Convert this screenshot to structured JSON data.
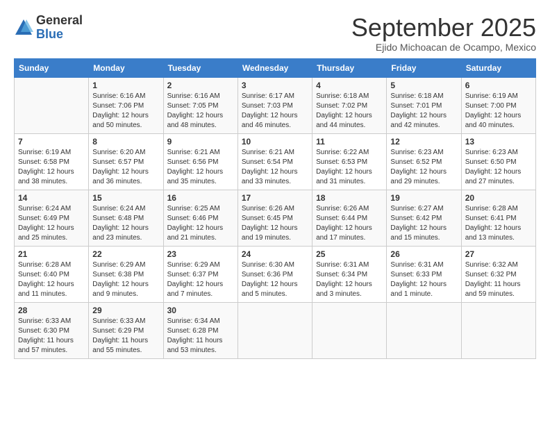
{
  "logo": {
    "general": "General",
    "blue": "Blue"
  },
  "header": {
    "month": "September 2025",
    "location": "Ejido Michoacan de Ocampo, Mexico"
  },
  "days_of_week": [
    "Sunday",
    "Monday",
    "Tuesday",
    "Wednesday",
    "Thursday",
    "Friday",
    "Saturday"
  ],
  "weeks": [
    [
      {
        "day": "",
        "info": ""
      },
      {
        "day": "1",
        "info": "Sunrise: 6:16 AM\nSunset: 7:06 PM\nDaylight: 12 hours\nand 50 minutes."
      },
      {
        "day": "2",
        "info": "Sunrise: 6:16 AM\nSunset: 7:05 PM\nDaylight: 12 hours\nand 48 minutes."
      },
      {
        "day": "3",
        "info": "Sunrise: 6:17 AM\nSunset: 7:03 PM\nDaylight: 12 hours\nand 46 minutes."
      },
      {
        "day": "4",
        "info": "Sunrise: 6:18 AM\nSunset: 7:02 PM\nDaylight: 12 hours\nand 44 minutes."
      },
      {
        "day": "5",
        "info": "Sunrise: 6:18 AM\nSunset: 7:01 PM\nDaylight: 12 hours\nand 42 minutes."
      },
      {
        "day": "6",
        "info": "Sunrise: 6:19 AM\nSunset: 7:00 PM\nDaylight: 12 hours\nand 40 minutes."
      }
    ],
    [
      {
        "day": "7",
        "info": "Sunrise: 6:19 AM\nSunset: 6:58 PM\nDaylight: 12 hours\nand 38 minutes."
      },
      {
        "day": "8",
        "info": "Sunrise: 6:20 AM\nSunset: 6:57 PM\nDaylight: 12 hours\nand 36 minutes."
      },
      {
        "day": "9",
        "info": "Sunrise: 6:21 AM\nSunset: 6:56 PM\nDaylight: 12 hours\nand 35 minutes."
      },
      {
        "day": "10",
        "info": "Sunrise: 6:21 AM\nSunset: 6:54 PM\nDaylight: 12 hours\nand 33 minutes."
      },
      {
        "day": "11",
        "info": "Sunrise: 6:22 AM\nSunset: 6:53 PM\nDaylight: 12 hours\nand 31 minutes."
      },
      {
        "day": "12",
        "info": "Sunrise: 6:23 AM\nSunset: 6:52 PM\nDaylight: 12 hours\nand 29 minutes."
      },
      {
        "day": "13",
        "info": "Sunrise: 6:23 AM\nSunset: 6:50 PM\nDaylight: 12 hours\nand 27 minutes."
      }
    ],
    [
      {
        "day": "14",
        "info": "Sunrise: 6:24 AM\nSunset: 6:49 PM\nDaylight: 12 hours\nand 25 minutes."
      },
      {
        "day": "15",
        "info": "Sunrise: 6:24 AM\nSunset: 6:48 PM\nDaylight: 12 hours\nand 23 minutes."
      },
      {
        "day": "16",
        "info": "Sunrise: 6:25 AM\nSunset: 6:46 PM\nDaylight: 12 hours\nand 21 minutes."
      },
      {
        "day": "17",
        "info": "Sunrise: 6:26 AM\nSunset: 6:45 PM\nDaylight: 12 hours\nand 19 minutes."
      },
      {
        "day": "18",
        "info": "Sunrise: 6:26 AM\nSunset: 6:44 PM\nDaylight: 12 hours\nand 17 minutes."
      },
      {
        "day": "19",
        "info": "Sunrise: 6:27 AM\nSunset: 6:42 PM\nDaylight: 12 hours\nand 15 minutes."
      },
      {
        "day": "20",
        "info": "Sunrise: 6:28 AM\nSunset: 6:41 PM\nDaylight: 12 hours\nand 13 minutes."
      }
    ],
    [
      {
        "day": "21",
        "info": "Sunrise: 6:28 AM\nSunset: 6:40 PM\nDaylight: 12 hours\nand 11 minutes."
      },
      {
        "day": "22",
        "info": "Sunrise: 6:29 AM\nSunset: 6:38 PM\nDaylight: 12 hours\nand 9 minutes."
      },
      {
        "day": "23",
        "info": "Sunrise: 6:29 AM\nSunset: 6:37 PM\nDaylight: 12 hours\nand 7 minutes."
      },
      {
        "day": "24",
        "info": "Sunrise: 6:30 AM\nSunset: 6:36 PM\nDaylight: 12 hours\nand 5 minutes."
      },
      {
        "day": "25",
        "info": "Sunrise: 6:31 AM\nSunset: 6:34 PM\nDaylight: 12 hours\nand 3 minutes."
      },
      {
        "day": "26",
        "info": "Sunrise: 6:31 AM\nSunset: 6:33 PM\nDaylight: 12 hours\nand 1 minute."
      },
      {
        "day": "27",
        "info": "Sunrise: 6:32 AM\nSunset: 6:32 PM\nDaylight: 11 hours\nand 59 minutes."
      }
    ],
    [
      {
        "day": "28",
        "info": "Sunrise: 6:33 AM\nSunset: 6:30 PM\nDaylight: 11 hours\nand 57 minutes."
      },
      {
        "day": "29",
        "info": "Sunrise: 6:33 AM\nSunset: 6:29 PM\nDaylight: 11 hours\nand 55 minutes."
      },
      {
        "day": "30",
        "info": "Sunrise: 6:34 AM\nSunset: 6:28 PM\nDaylight: 11 hours\nand 53 minutes."
      },
      {
        "day": "",
        "info": ""
      },
      {
        "day": "",
        "info": ""
      },
      {
        "day": "",
        "info": ""
      },
      {
        "day": "",
        "info": ""
      }
    ]
  ]
}
